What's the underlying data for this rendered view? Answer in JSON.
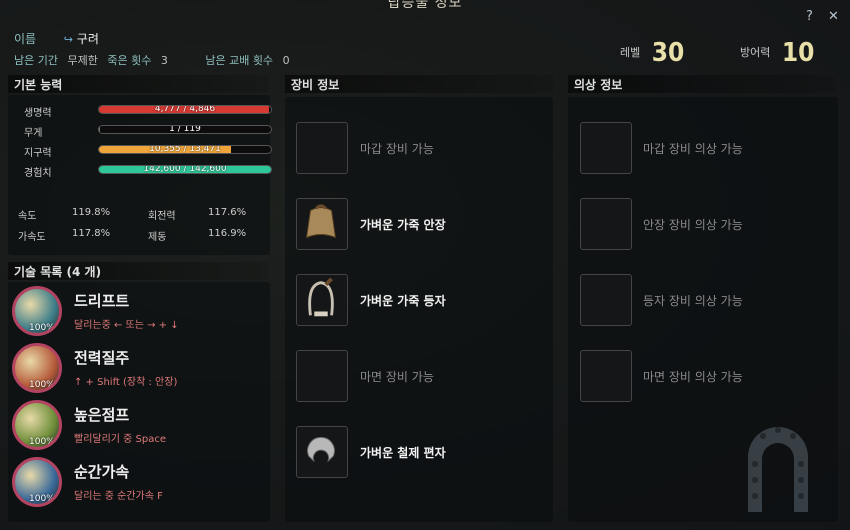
{
  "window": {
    "title": "탑승물 정보",
    "help_icon": "?",
    "close_icon": "✕"
  },
  "info": {
    "name_label": "이름",
    "name_value": "구려",
    "remaining_period_label": "남은 기간",
    "remaining_period_value": "무제한",
    "deaths_label": "죽은 횟수",
    "deaths_value": "3",
    "swaps_label": "남은 교배 횟수",
    "swaps_value": "0",
    "level_label": "레벨",
    "level_value": "30",
    "defense_label": "방어력",
    "defense_value": "10"
  },
  "basic": {
    "title": "기본 능력",
    "bars": [
      {
        "label": "생명력",
        "text": "4,777 / 4,846",
        "ratio": 0.986,
        "color": "#d73a32"
      },
      {
        "label": "무게",
        "text": "1 / 119",
        "ratio": 0.008,
        "color": "#8a8a8a"
      },
      {
        "label": "지구력",
        "text": "10,355 / 13,471",
        "ratio": 0.769,
        "color": "#f0a53a"
      },
      {
        "label": "경험치",
        "text": "142,600 / 142,600",
        "ratio": 1.0,
        "color": "#2ec79a"
      }
    ],
    "speed_label": "속도",
    "speed_value": "119.8%",
    "turn_label": "회전력",
    "turn_value": "117.6%",
    "accel_label": "가속도",
    "accel_value": "117.8%",
    "brake_label": "제동",
    "brake_value": "116.9%"
  },
  "skills": {
    "title": "기술 목록 (4 개)",
    "items": [
      {
        "name": "드리프트",
        "key": "달리는중 ← 또는 → + ↓",
        "pct": "100%",
        "icon": "drift-skill-icon"
      },
      {
        "name": "전력질주",
        "key": "↑ + Shift (장착 : 안장)",
        "pct": "100%",
        "icon": "sprint-skill-icon"
      },
      {
        "name": "높은점프",
        "key": "빨리달리기 중 Space",
        "pct": "100%",
        "icon": "high-jump-skill-icon"
      },
      {
        "name": "순간가속",
        "key": "달리는 중 순간가속 F",
        "pct": "100%",
        "icon": "instant-accel-skill-icon"
      }
    ]
  },
  "equipment": {
    "title": "장비 정보",
    "slots": [
      {
        "text": "마갑 장비 가능",
        "filled": false,
        "icon": "empty-slot-icon"
      },
      {
        "text": "가벼운 가죽 안장",
        "filled": true,
        "icon": "saddle-icon"
      },
      {
        "text": "가벼운 가죽 등자",
        "filled": true,
        "icon": "stirrup-icon"
      },
      {
        "text": "마면 장비 가능",
        "filled": false,
        "icon": "empty-slot-icon"
      },
      {
        "text": "가벼운 철제 편자",
        "filled": true,
        "icon": "horseshoe-icon"
      }
    ]
  },
  "costume": {
    "title": "의상 정보",
    "slots": [
      {
        "text": "마갑 장비 의상 가능"
      },
      {
        "text": "안장 장비 의상 가능"
      },
      {
        "text": "등자 장비 의상 가능"
      },
      {
        "text": "마면 장비 의상 가능"
      }
    ]
  }
}
